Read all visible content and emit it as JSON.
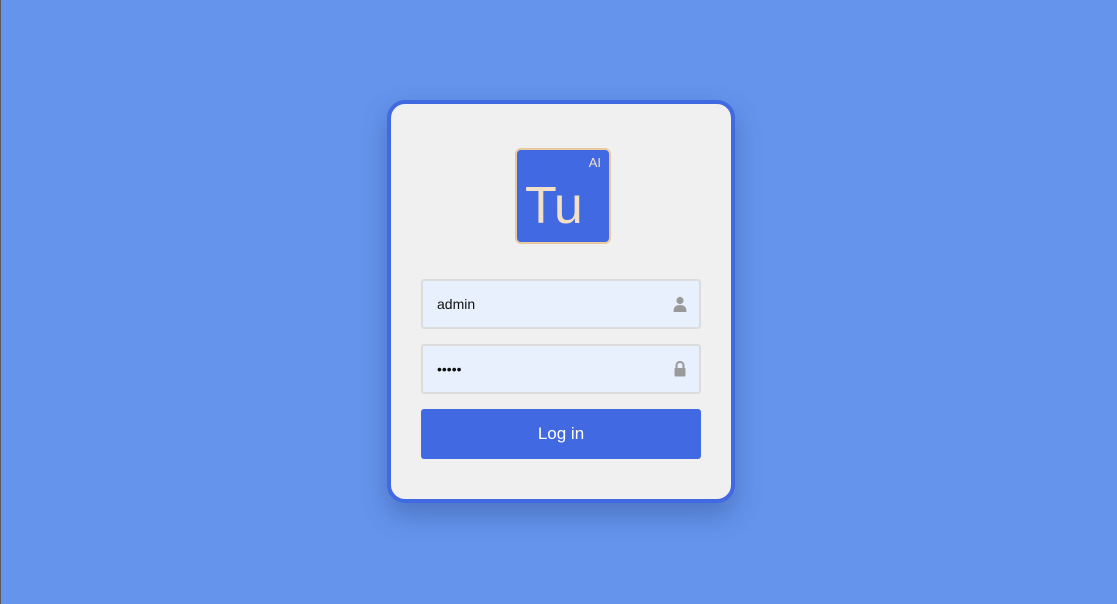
{
  "logo": {
    "main_text": "Tu",
    "superscript": "AI"
  },
  "login_form": {
    "username_value": "admin",
    "password_value": "•••••",
    "user_icon": "user-icon",
    "lock_icon": "lock-icon",
    "submit_label": "Log in"
  },
  "colors": {
    "background": "#6494EC",
    "accent": "#4169E1",
    "card": "#F0F0F0",
    "input_fill": "#E8F0FE",
    "logo_text": "#F3E0C8"
  }
}
